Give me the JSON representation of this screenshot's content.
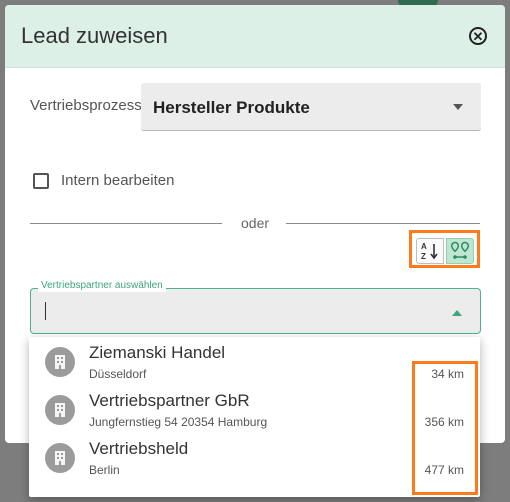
{
  "modal": {
    "title": "Lead zuweisen"
  },
  "process": {
    "label": "Vertriebsprozess",
    "value": "Hersteller Produkte"
  },
  "internal": {
    "label": "Intern bearbeiten",
    "checked": false
  },
  "divider": {
    "text": "oder"
  },
  "sort": {
    "alphabetical_icon": "sort-alpha-icon",
    "distance_icon": "route-distance-icon",
    "active": "distance"
  },
  "partner_select": {
    "label": "Vertriebspartner auswählen",
    "value": ""
  },
  "partners": [
    {
      "name": "Ziemanski Handel",
      "address": "Düsseldorf",
      "distance": "34 km",
      "icon": "building-icon"
    },
    {
      "name": "Vertriebspartner GbR",
      "address": "Jungfernstieg 54 20354 Hamburg",
      "distance": "356 km",
      "icon": "building-icon"
    },
    {
      "name": "Vertriebsheld",
      "address": "Berlin",
      "distance": "477 km",
      "icon": "building-icon"
    }
  ],
  "colors": {
    "header_bg": "#dcf0e8",
    "accent": "#3fa57a",
    "highlight": "#ff7a1a"
  }
}
